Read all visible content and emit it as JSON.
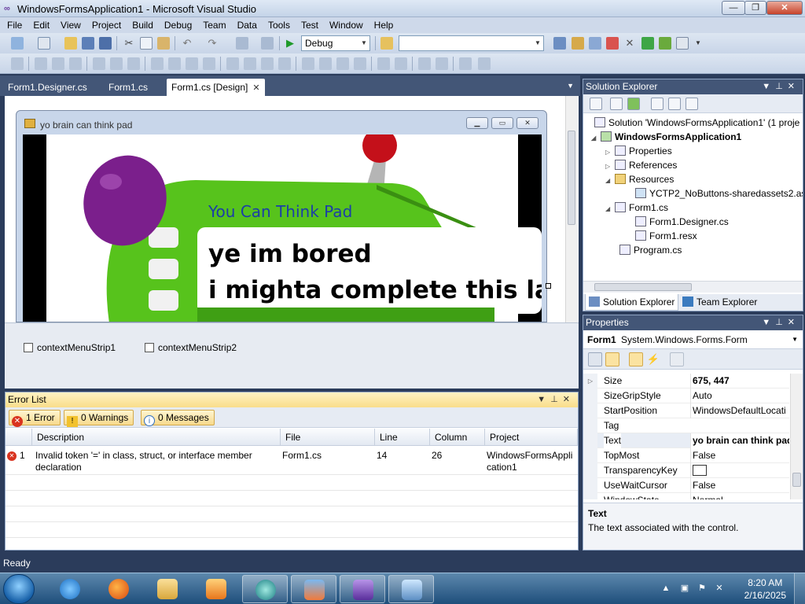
{
  "window": {
    "title": "WindowsFormsApplication1 - Microsoft Visual Studio"
  },
  "menu": [
    "File",
    "Edit",
    "View",
    "Project",
    "Build",
    "Debug",
    "Team",
    "Data",
    "Tools",
    "Test",
    "Window",
    "Help"
  ],
  "toolbar": {
    "config": "Debug",
    "platform": ""
  },
  "doc_tabs": [
    {
      "label": "Form1.Designer.cs"
    },
    {
      "label": "Form1.cs"
    },
    {
      "label": "Form1.cs [Design]",
      "active": true
    }
  ],
  "form": {
    "title": "yo brain can think pad",
    "gadget_title": "You Can Think Pad",
    "screen_line1": "ye im bored",
    "screen_line2": "i mighta complete this later"
  },
  "tray_components": [
    "contextMenuStrip1",
    "contextMenuStrip2"
  ],
  "error_list": {
    "title": "Error List",
    "filters": {
      "errors": "1 Error",
      "warnings": "0 Warnings",
      "messages": "0 Messages"
    },
    "columns": [
      "Description",
      "File",
      "Line",
      "Column",
      "Project"
    ],
    "rows": [
      {
        "num": "1",
        "description_line1": "Invalid token '=' in class, struct, or interface member",
        "description_line2": "declaration",
        "file": "Form1.cs",
        "line": "14",
        "column": "26",
        "project_line1": "WindowsFormsAppli",
        "project_line2": "cation1"
      }
    ]
  },
  "solution_explorer": {
    "title": "Solution Explorer",
    "nodes": [
      "Solution 'WindowsFormsApplication1' (1 proje",
      "WindowsFormsApplication1",
      "Properties",
      "References",
      "Resources",
      "YCTP2_NoButtons-sharedassets2.as",
      "Form1.cs",
      "Form1.Designer.cs",
      "Form1.resx",
      "Program.cs"
    ],
    "tabs": [
      "Solution Explorer",
      "Team Explorer"
    ]
  },
  "properties": {
    "title": "Properties",
    "object_name": "Form1",
    "object_type": "System.Windows.Forms.Form",
    "rows": [
      {
        "name": "Size",
        "value": "675, 447"
      },
      {
        "name": "SizeGripStyle",
        "value": "Auto"
      },
      {
        "name": "StartPosition",
        "value": "WindowsDefaultLocati"
      },
      {
        "name": "Tag",
        "value": ""
      },
      {
        "name": "Text",
        "value": "yo brain can think pad"
      },
      {
        "name": "TopMost",
        "value": "False"
      },
      {
        "name": "TransparencyKey",
        "value": ""
      },
      {
        "name": "UseWaitCursor",
        "value": "False"
      },
      {
        "name": "WindowState",
        "value": "Normal"
      }
    ],
    "desc_title": "Text",
    "desc_text": "The text associated with the control."
  },
  "status": "Ready",
  "taskbar": {
    "time": "8:20 AM",
    "date": "2/16/2025"
  },
  "colors": {
    "accent": "#435677",
    "error": "#d9331f",
    "warning": "#f2c22e",
    "info": "#2f6fbf"
  }
}
